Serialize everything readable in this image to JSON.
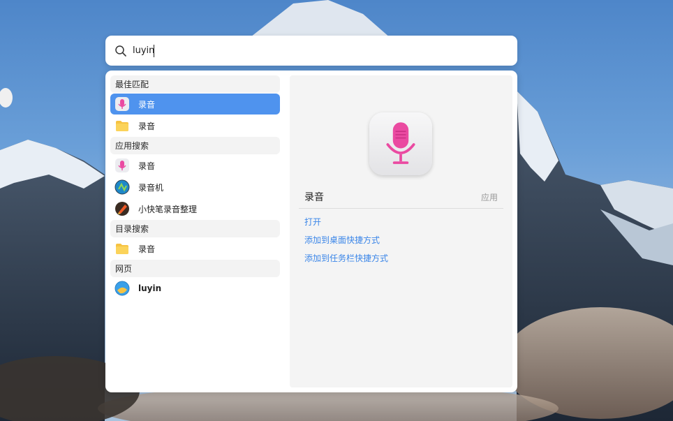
{
  "search": {
    "value": "luyin",
    "placeholder": ""
  },
  "results": {
    "sections": [
      {
        "title": "最佳匹配",
        "items": [
          {
            "label": "录音",
            "icon": "microphone-app-icon",
            "selected": true
          },
          {
            "label": "录音",
            "icon": "folder-icon"
          }
        ]
      },
      {
        "title": "应用搜索",
        "items": [
          {
            "label": "录音",
            "icon": "microphone-app-icon"
          },
          {
            "label": "录音机",
            "icon": "recorder-app-icon"
          },
          {
            "label": "小快笔录音整理",
            "icon": "pen-app-icon"
          }
        ]
      },
      {
        "title": "目录搜索",
        "items": [
          {
            "label": "录音",
            "icon": "folder-icon"
          }
        ]
      },
      {
        "title": "网页",
        "items": [
          {
            "label": "luyin",
            "icon": "web-search-icon",
            "bold": true
          }
        ]
      }
    ]
  },
  "detail": {
    "name": "录音",
    "type": "应用",
    "actions": [
      "打开",
      "添加到桌面快捷方式",
      "添加到任务栏快捷方式"
    ]
  },
  "colors": {
    "accent": "#4f93ee",
    "link": "#3b86e8",
    "mic": "#e94aa0"
  }
}
